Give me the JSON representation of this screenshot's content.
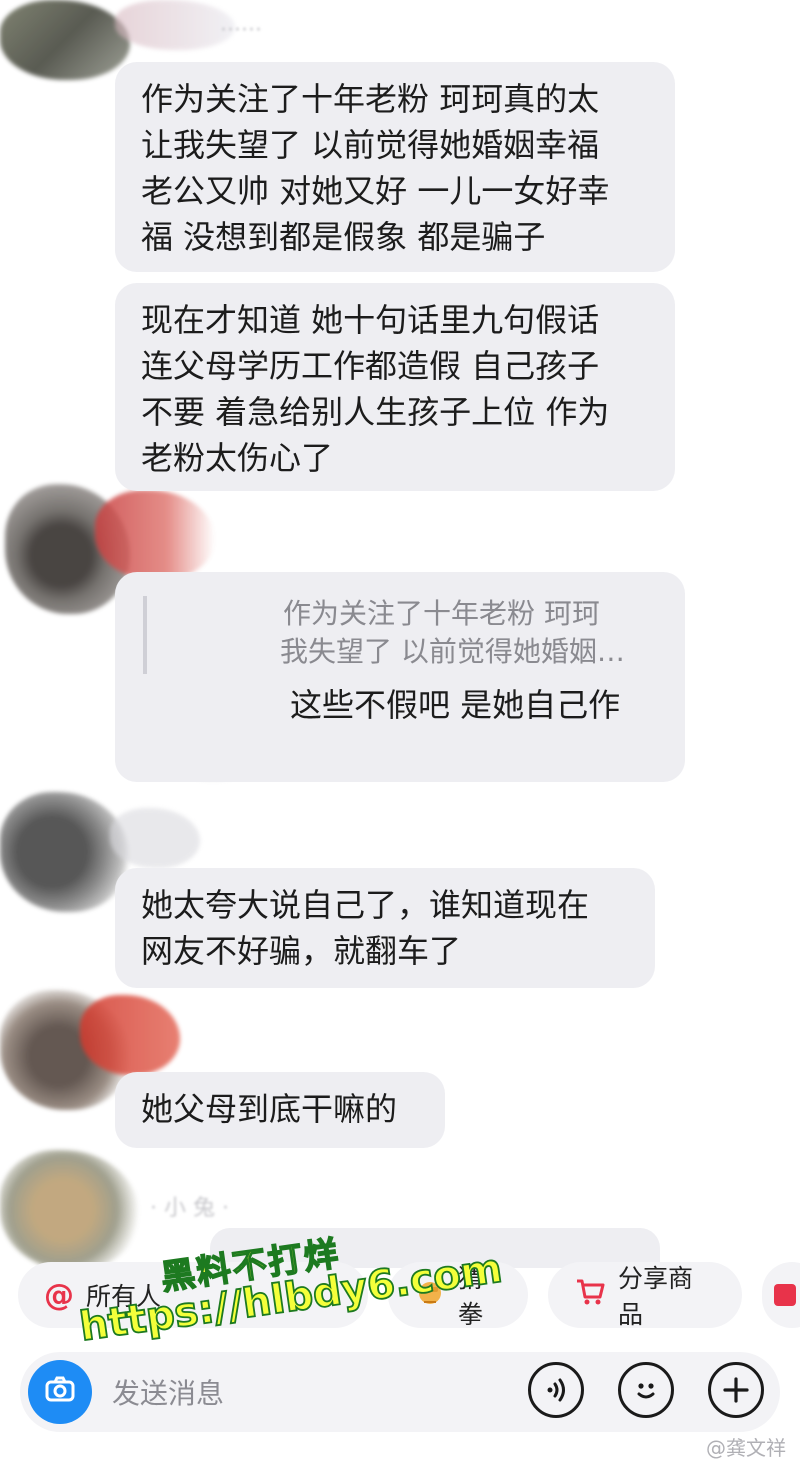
{
  "messages": {
    "m1": [
      "作为关注了十年老粉 珂珂真的太",
      "让我失望了 以前觉得她婚姻幸福",
      "老公又帅 对她又好 一儿一女好幸",
      "福 没想到都是假象 都是骗子"
    ],
    "m2": [
      "现在才知道 她十句话里九句假话",
      "连父母学历工作都造假 自己孩子",
      "不要 着急给别人生孩子上位 作为",
      "老粉太伤心了"
    ],
    "quote": {
      "line1": "作为关注了十年老粉 珂珂",
      "line2": "我失望了 以前觉得她婚姻…",
      "reply": "这些不假吧 是她自己作"
    },
    "m4": [
      "她太夸大说自己了，谁知道现在",
      "网友不好骗，就翻车了"
    ],
    "m5": [
      "她父母到底干嘛的"
    ]
  },
  "chips": {
    "all": "所有人",
    "guess": "猜拳",
    "share": "分享商品"
  },
  "input": {
    "placeholder": "发送消息"
  },
  "watermark": {
    "line1": "黑料不打烊",
    "line2": "https://hlbdy6.com"
  },
  "credit": "@龚文祥",
  "colors": {
    "bubble": "#eeeef2",
    "accent": "#1e8cf5",
    "mention": "#e8334a",
    "cart": "#e8334a"
  },
  "icons": {
    "camera": "camera-icon",
    "voice": "voice-icon",
    "emoji": "emoji-icon",
    "plus": "plus-icon",
    "at": "at-icon",
    "fist": "fist-icon",
    "cart": "cart-icon"
  }
}
